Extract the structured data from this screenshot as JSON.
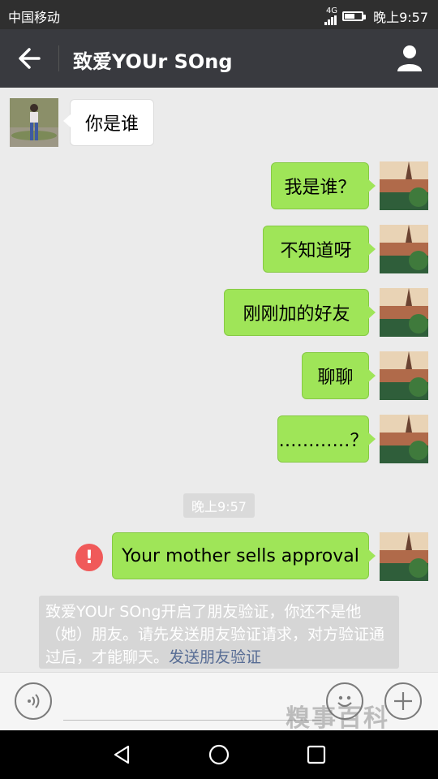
{
  "status_bar": {
    "carrier": "中国移动",
    "signal_label": "4G",
    "time": "晚上9:57",
    "battery_fill": 0.6
  },
  "header": {
    "title": "致爱YOUr  SOng",
    "back_icon": "arrow-left-icon",
    "profile_icon": "person-icon"
  },
  "messages": [
    {
      "side": "left",
      "text": "你是谁"
    },
    {
      "side": "right",
      "text": "我是谁？"
    },
    {
      "side": "right",
      "text": "不知道呀"
    },
    {
      "side": "right",
      "text": "刚刚加的好友"
    },
    {
      "side": "right",
      "text": "聊聊"
    },
    {
      "side": "right",
      "text": "…………？"
    },
    {
      "side": "right",
      "text": "Your mother sells approval",
      "error": true
    }
  ],
  "timestamp": "晚上9:57",
  "system_notice": {
    "text": "致爱YOUr  SOng开启了朋友验证，你还不是他（她）朋友。请先发送朋友验证请求，对方验证通过后，才能聊天。",
    "link": "发送朋友验证"
  },
  "input_bar": {
    "voice_icon": "voice-icon",
    "emoji_icon": "emoji-icon",
    "plus_icon": "plus-icon"
  },
  "watermark": "糗事百科",
  "colors": {
    "header_bg": "#393a3f",
    "bubble_sent": "#9fe558",
    "error": "#f05a5a",
    "link": "#586d95"
  }
}
